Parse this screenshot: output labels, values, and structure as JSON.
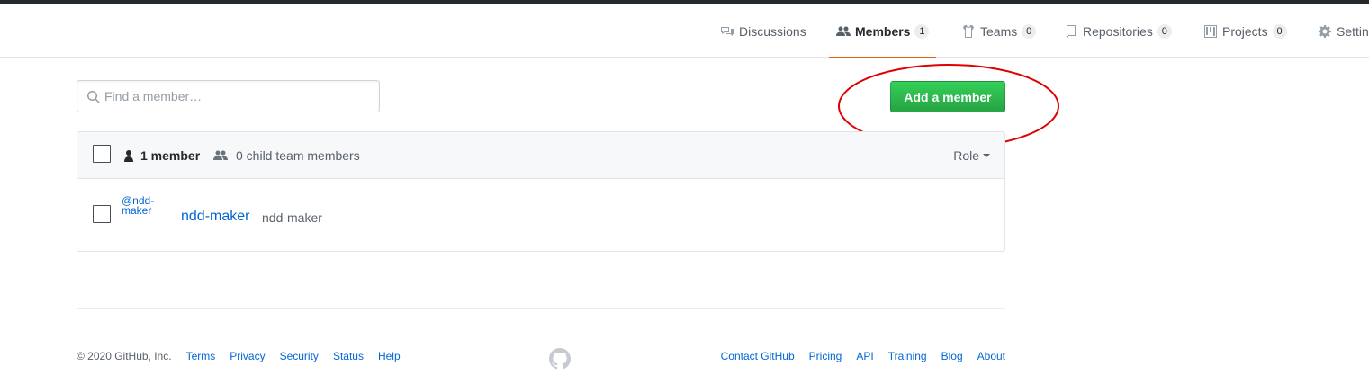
{
  "nav": {
    "tabs": [
      {
        "label": "Discussions",
        "icon": "comment-discussion-icon"
      },
      {
        "label": "Members",
        "count": "1",
        "icon": "people-icon",
        "selected": true
      },
      {
        "label": "Teams",
        "count": "0",
        "icon": "jersey-icon"
      },
      {
        "label": "Repositories",
        "count": "0",
        "icon": "repo-icon"
      },
      {
        "label": "Projects",
        "count": "0",
        "icon": "project-icon"
      },
      {
        "label": "Settings",
        "icon": "gear-icon"
      }
    ]
  },
  "search": {
    "placeholder": "Find a member…",
    "value": ""
  },
  "add_button": {
    "label": "Add a member"
  },
  "members": {
    "header": {
      "member_count": "1 member",
      "child_count": "0 child team members",
      "role_label": "Role"
    },
    "rows": [
      {
        "avatar_alt": "@ndd-maker",
        "name": "ndd-maker",
        "login": "ndd-maker"
      }
    ]
  },
  "footer": {
    "copyright": "© 2020 GitHub, Inc.",
    "left_links": [
      "Terms",
      "Privacy",
      "Security",
      "Status",
      "Help"
    ],
    "right_links": [
      "Contact GitHub",
      "Pricing",
      "API",
      "Training",
      "Blog",
      "About"
    ]
  },
  "colors": {
    "accent_tab": "#e36209",
    "primary_button": "#28a745",
    "link": "#0366d6",
    "annotation": "#e00000"
  }
}
